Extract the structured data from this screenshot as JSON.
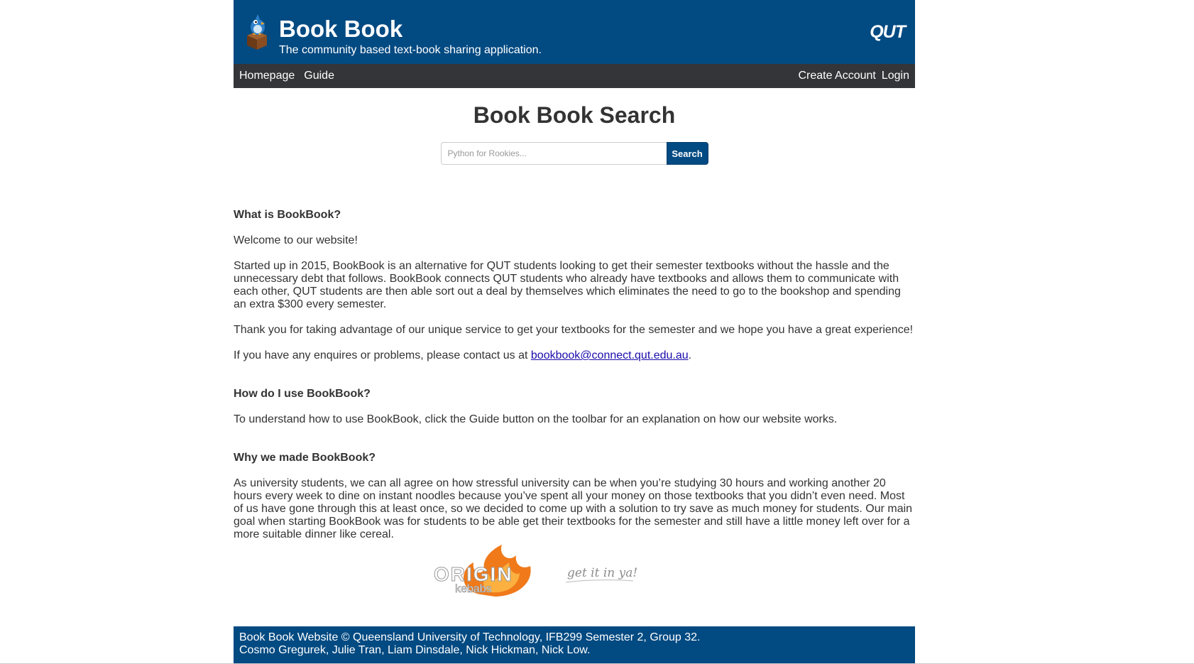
{
  "header": {
    "title": "Book Book",
    "tagline": "The community based text-book sharing application.",
    "institution_logo": "QUT"
  },
  "nav": {
    "left": [
      "Homepage",
      "Guide"
    ],
    "right": [
      "Create Account",
      "Login"
    ]
  },
  "search": {
    "title": "Book Book Search",
    "placeholder": "Python for Rookies...",
    "value": "",
    "button_label": "Search"
  },
  "sections": {
    "what": {
      "heading": "What is BookBook?",
      "p1": "Welcome to our website!",
      "p2": "Started up in 2015, BookBook is an alternative for QUT students looking to get their semester textbooks without the hassle and the unnecessary debt that follows. BookBook connects QUT students who already have textbooks and allows them to communicate with each other, QUT students are then able sort out a deal by themselves which eliminates the need to go to the bookshop and spending an extra $300 every semester.",
      "p3": "Thank you for taking advantage of our unique service to get your textbooks for the semester and we hope you have a great experience!",
      "p4_prefix": "If you have any enquires or problems, please contact us at ",
      "email": "bookbook@connect.qut.edu.au",
      "p4_suffix": "."
    },
    "how": {
      "heading": "How do I use BookBook?",
      "p1": "To understand how to use BookBook, click the Guide button on the toolbar for an explanation on how our website works."
    },
    "why": {
      "heading": "Why we made BookBook?",
      "p1": "As university students, we can all agree on how stressful university can be when you’re studying 30 hours and working another 20 hours every week to dine on instant noodles because you’ve spent all your money on those textbooks that you didn’t even need. Most of us have gone through this at least once, so we decided to come up with a solution to try save as much money for students. Our main goal when starting BookBook was for students to be able get their textbooks for the semester and still have a little money left over for a more suitable dinner like cereal."
    }
  },
  "sponsor": {
    "brand": "ORIGIN",
    "sub": "kebabs",
    "slogan": "get it in ya!"
  },
  "footer": {
    "line1": "Book Book Website © Queensland University of Technology, IFB299 Semester 2, Group 32.",
    "line2": "Cosmo Gregurek, Julie Tran, Liam Dinsdale, Nick Hickman, Nick Low."
  },
  "colors": {
    "brand_blue": "#024a82",
    "nav_dark": "#333538",
    "flame_orange": "#f07a1a"
  },
  "icons": {
    "logo": "bird-on-book-icon",
    "sponsor": "flame-logo"
  }
}
